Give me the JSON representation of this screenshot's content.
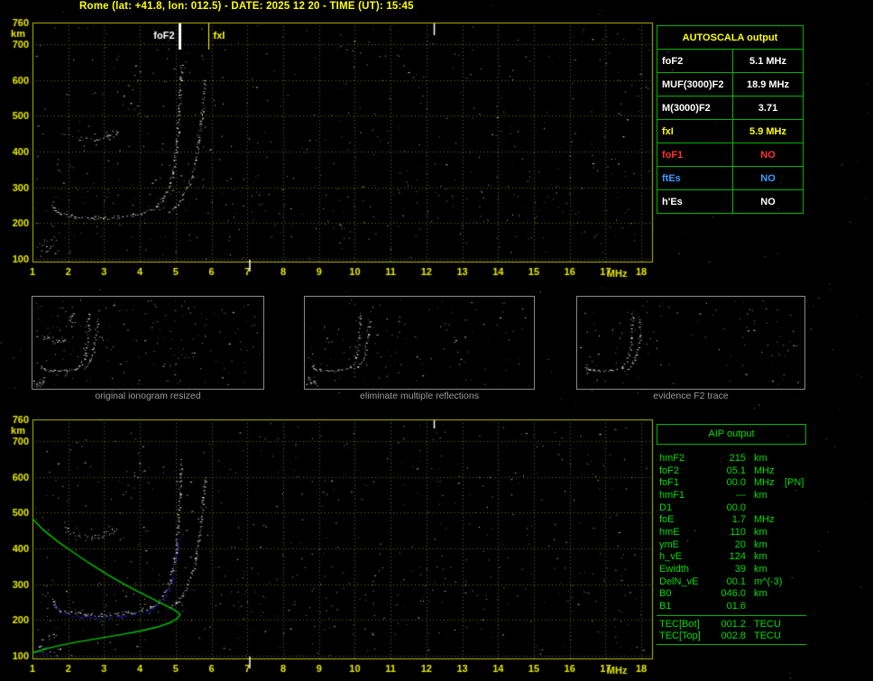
{
  "header": {
    "title": "Rome (lat: +41.8, lon: 012.5) - DATE: 2025 12 20 - TIME (UT): 15:45"
  },
  "colors": {
    "background": "#000000",
    "title_yellow": "#ffff00",
    "axis_text": "#e8e800",
    "plot_border": "#b9b900",
    "grid": "#6f6f00",
    "table_green": "#00b400",
    "aip_text": "#00dd00",
    "caption_gray": "#9a9a9a",
    "trace_white": "#ffffff",
    "trace_blue": "#2828ff",
    "profile_green": "#00c800",
    "status_red": "#ff3232",
    "status_blue": "#3d9bff"
  },
  "autoscala_table": {
    "title": "AUTOSCALA output",
    "rows": [
      {
        "label": "foF2",
        "value": "5.1 MHz",
        "color": "#ffffff"
      },
      {
        "label": "MUF(3000)F2",
        "value": "18.9 MHz",
        "color": "#ffffff"
      },
      {
        "label": "M(3000)F2",
        "value": "3.71",
        "color": "#ffffff"
      },
      {
        "label": "fxI",
        "value": "5.9 MHz",
        "color": "#ffff00"
      },
      {
        "label": "foF1",
        "value": "NO",
        "color": "#ff3232"
      },
      {
        "label": "ftEs",
        "value": "NO",
        "color": "#3d9bff"
      },
      {
        "label": "h'Es",
        "value": "NO",
        "color": "#ffffff"
      }
    ]
  },
  "aip_table": {
    "title": "AIP output",
    "rows": [
      {
        "label": "hmF2",
        "value": "215",
        "unit": "km"
      },
      {
        "label": "foF2",
        "value": "05.1",
        "unit": "MHz"
      },
      {
        "label": "foF1",
        "value": "00.0",
        "unit": "MHz",
        "note": "[PN]"
      },
      {
        "label": "hmF1",
        "value": "---",
        "unit": "km"
      },
      {
        "label": "D1",
        "value": "00.0",
        "unit": ""
      },
      {
        "label": "foE",
        "value": "1.7",
        "unit": "MHz"
      },
      {
        "label": "hmE",
        "value": "110",
        "unit": "km"
      },
      {
        "label": "ymE",
        "value": "20",
        "unit": "km"
      },
      {
        "label": "h_vE",
        "value": "124",
        "unit": "km"
      },
      {
        "label": "Ewidth",
        "value": "39",
        "unit": "km"
      },
      {
        "label": "DelN_vE",
        "value": "00.1",
        "unit": "m^(-3)"
      },
      {
        "label": "B0",
        "value": "046.0",
        "unit": "km"
      },
      {
        "label": "B1",
        "value": "01.6",
        "unit": ""
      }
    ],
    "tec": [
      {
        "label": "TEC[Bot]",
        "value": "001.2",
        "unit": "TECU"
      },
      {
        "label": "TEC[Top]",
        "value": "002.8",
        "unit": "TECU"
      }
    ]
  },
  "thumbnails": [
    {
      "caption": "original ionogram resized",
      "seed": 11,
      "noise": 180,
      "skip": []
    },
    {
      "caption": "eliminate multiple reflections",
      "seed": 12,
      "noise": 125,
      "skip": [
        "E-multiples",
        "F-multiples"
      ]
    },
    {
      "caption": "evidence F2 trace",
      "seed": 13,
      "noise": 110,
      "skip": [
        "E-multiples",
        "F-multiples",
        "low-left-cluster"
      ]
    }
  ],
  "chart_data": [
    {
      "id": "top_ionogram",
      "type": "scatter",
      "title": "scaled ionogram",
      "xlabel": "MHz",
      "ylabel": "km",
      "xlim": [
        1,
        18.3
      ],
      "ylim": [
        93,
        760
      ],
      "xticks": [
        1,
        2,
        3,
        4,
        5,
        6,
        7,
        8,
        9,
        10,
        11,
        12,
        13,
        14,
        15,
        16,
        17,
        18
      ],
      "yticks": [
        100,
        200,
        300,
        400,
        500,
        600,
        700,
        760
      ],
      "grid": true,
      "annotations": [
        {
          "label": "foF2",
          "x": 5.1,
          "color": "#ffffff",
          "thick": 3,
          "side": "left"
        },
        {
          "label": "fxI",
          "x": 5.9,
          "color": "#ffff00",
          "thick": 1,
          "side": "right"
        }
      ],
      "rfi": [
        {
          "x": 12.2,
          "edge": "top",
          "len": 13
        },
        {
          "x": 7.05,
          "edge": "bottom",
          "len": 13
        }
      ],
      "series": [
        {
          "name": "E-F1-trace",
          "color": "#ffffff",
          "style": "trace",
          "width": 2,
          "points": [
            [
              1.55,
              258
            ],
            [
              1.62,
              240
            ],
            [
              1.75,
              228
            ],
            [
              1.95,
              222
            ],
            [
              2.2,
              218
            ],
            [
              2.6,
              216
            ],
            [
              3.0,
              216
            ],
            [
              3.4,
              218
            ],
            [
              3.75,
              222
            ],
            [
              4.05,
              228
            ],
            [
              4.3,
              237
            ],
            [
              4.45,
              248
            ]
          ]
        },
        {
          "name": "F2-O-trace",
          "color": "#ffffff",
          "style": "trace",
          "width": 2,
          "points": [
            [
              4.45,
              248
            ],
            [
              4.6,
              264
            ],
            [
              4.72,
              284
            ],
            [
              4.82,
              308
            ],
            [
              4.9,
              338
            ],
            [
              4.96,
              372
            ],
            [
              5.01,
              412
            ],
            [
              5.05,
              458
            ],
            [
              5.08,
              508
            ],
            [
              5.11,
              558
            ],
            [
              5.13,
              606
            ],
            [
              5.15,
              645
            ]
          ]
        },
        {
          "name": "F2-X-trace",
          "color": "#ffffff",
          "style": "trace",
          "width": 1.5,
          "points": [
            [
              4.78,
              232
            ],
            [
              4.98,
              248
            ],
            [
              5.16,
              270
            ],
            [
              5.32,
              298
            ],
            [
              5.45,
              332
            ],
            [
              5.55,
              375
            ],
            [
              5.63,
              425
            ],
            [
              5.7,
              485
            ],
            [
              5.76,
              545
            ],
            [
              5.8,
              600
            ]
          ]
        },
        {
          "name": "E-multiples",
          "color": "#ffffff",
          "style": "cluster",
          "points": [
            [
              1.9,
              452
            ],
            [
              2.05,
              446
            ],
            [
              2.2,
              441
            ],
            [
              2.35,
              437
            ],
            [
              2.5,
              435
            ],
            [
              2.65,
              434
            ],
            [
              2.8,
              435
            ],
            [
              2.95,
              437
            ],
            [
              3.1,
              440
            ],
            [
              3.25,
              443
            ],
            [
              1.95,
              462
            ],
            [
              2.3,
              454
            ],
            [
              2.7,
              449
            ],
            [
              3.05,
              451
            ],
            [
              3.3,
              456
            ]
          ]
        },
        {
          "name": "F-multiples",
          "color": "#ffffff",
          "style": "cluster",
          "points": [
            [
              3.6,
              558
            ],
            [
              3.72,
              582
            ],
            [
              3.85,
              608
            ],
            [
              3.68,
              540
            ],
            [
              3.82,
              568
            ],
            [
              3.95,
              598
            ],
            [
              3.92,
              636
            ],
            [
              4.05,
              620
            ]
          ]
        },
        {
          "name": "low-left-cluster",
          "color": "#ffffff",
          "style": "cluster",
          "points": [
            [
              1.2,
              128
            ],
            [
              1.35,
              120
            ],
            [
              1.55,
              112
            ],
            [
              1.3,
              142
            ],
            [
              1.5,
              132
            ],
            [
              1.7,
              120
            ],
            [
              1.4,
              152
            ],
            [
              1.6,
              158
            ],
            [
              1.25,
              108
            ]
          ]
        }
      ]
    },
    {
      "id": "bottom_ionogram",
      "type": "scatter",
      "title": "ionogram with autoscaled trace and electron density profile",
      "xlabel": "MHz",
      "ylabel": "km",
      "xlim": [
        1,
        18.3
      ],
      "ylim": [
        93,
        760
      ],
      "xticks": [
        1,
        2,
        3,
        4,
        5,
        6,
        7,
        8,
        9,
        10,
        11,
        12,
        13,
        14,
        15,
        16,
        17,
        18
      ],
      "yticks": [
        100,
        200,
        300,
        400,
        500,
        600,
        700,
        760
      ],
      "grid": true,
      "annotations": [],
      "rfi": [
        {
          "x": 12.2,
          "edge": "top",
          "len": 9
        },
        {
          "x": 7.05,
          "edge": "bottom",
          "len": 13
        }
      ],
      "series": [
        {
          "name": "E-F1-trace",
          "color": "#ffffff",
          "style": "trace",
          "width": 2,
          "points": [
            [
              1.55,
              258
            ],
            [
              1.62,
              240
            ],
            [
              1.75,
              228
            ],
            [
              1.95,
              222
            ],
            [
              2.2,
              218
            ],
            [
              2.6,
              216
            ],
            [
              3.0,
              216
            ],
            [
              3.4,
              218
            ],
            [
              3.75,
              222
            ],
            [
              4.05,
              228
            ],
            [
              4.3,
              237
            ],
            [
              4.45,
              248
            ]
          ]
        },
        {
          "name": "F2-O-trace",
          "color": "#ffffff",
          "style": "trace",
          "width": 2,
          "points": [
            [
              4.45,
              248
            ],
            [
              4.6,
              264
            ],
            [
              4.72,
              284
            ],
            [
              4.82,
              308
            ],
            [
              4.9,
              338
            ],
            [
              4.96,
              372
            ],
            [
              5.01,
              412
            ],
            [
              5.05,
              458
            ],
            [
              5.08,
              508
            ],
            [
              5.11,
              558
            ],
            [
              5.13,
              606
            ],
            [
              5.15,
              645
            ]
          ]
        },
        {
          "name": "F2-X-trace",
          "color": "#ffffff",
          "style": "trace",
          "width": 1.5,
          "points": [
            [
              4.78,
              232
            ],
            [
              4.98,
              248
            ],
            [
              5.16,
              270
            ],
            [
              5.32,
              298
            ],
            [
              5.45,
              332
            ],
            [
              5.55,
              375
            ],
            [
              5.63,
              425
            ],
            [
              5.7,
              485
            ],
            [
              5.76,
              545
            ],
            [
              5.8,
              600
            ]
          ]
        },
        {
          "name": "E-multiples",
          "color": "#ffffff",
          "style": "cluster",
          "points": [
            [
              1.9,
              452
            ],
            [
              2.05,
              446
            ],
            [
              2.2,
              441
            ],
            [
              2.35,
              437
            ],
            [
              2.5,
              435
            ],
            [
              2.65,
              434
            ],
            [
              2.8,
              435
            ],
            [
              2.95,
              437
            ],
            [
              3.1,
              440
            ],
            [
              3.25,
              443
            ],
            [
              1.95,
              462
            ],
            [
              2.3,
              454
            ],
            [
              2.7,
              449
            ],
            [
              3.05,
              451
            ],
            [
              3.3,
              456
            ]
          ]
        },
        {
          "name": "F-multiples",
          "color": "#ffffff",
          "style": "cluster",
          "points": [
            [
              3.6,
              558
            ],
            [
              3.72,
              582
            ],
            [
              3.85,
              608
            ],
            [
              3.68,
              540
            ],
            [
              3.82,
              568
            ],
            [
              3.95,
              598
            ],
            [
              3.92,
              636
            ],
            [
              4.05,
              620
            ]
          ]
        },
        {
          "name": "low-left-cluster",
          "color": "#ffffff",
          "style": "cluster",
          "points": [
            [
              1.2,
              128
            ],
            [
              1.35,
              120
            ],
            [
              1.55,
              112
            ],
            [
              1.3,
              142
            ],
            [
              1.5,
              132
            ],
            [
              1.7,
              120
            ],
            [
              1.4,
              152
            ],
            [
              1.6,
              158
            ],
            [
              1.25,
              108
            ]
          ]
        },
        {
          "name": "autoscala-E-points",
          "color": "#2828ff",
          "style": "trace",
          "width": 2,
          "points": [
            [
              1.6,
              250
            ],
            [
              1.75,
              222
            ],
            [
              2.0,
              215
            ],
            [
              2.3,
              211
            ],
            [
              2.7,
              209
            ],
            [
              3.1,
              209
            ],
            [
              3.5,
              211
            ],
            [
              3.9,
              216
            ],
            [
              4.2,
              223
            ],
            [
              4.45,
              240
            ]
          ]
        },
        {
          "name": "autoscala-F2-points",
          "color": "#2828ff",
          "style": "trace",
          "width": 2,
          "points": [
            [
              4.45,
              240
            ],
            [
              4.65,
              258
            ],
            [
              4.8,
              282
            ],
            [
              4.9,
              315
            ],
            [
              4.97,
              360
            ],
            [
              5.03,
              405
            ],
            [
              5.08,
              430
            ]
          ]
        },
        {
          "name": "corner-blue-cluster",
          "color": "#2828ff",
          "style": "cluster",
          "points": [
            [
              1.02,
              98
            ],
            [
              1.1,
              106
            ],
            [
              1.25,
              102
            ],
            [
              1.05,
              116
            ],
            [
              1.18,
              95
            ],
            [
              1.35,
              99
            ],
            [
              1.03,
              128
            ],
            [
              1.45,
              105
            ],
            [
              1.6,
              100
            ]
          ]
        }
      ],
      "profile": {
        "name": "electron-density-profile",
        "color": "#00c800",
        "points": [
          [
            1.0,
            483
          ],
          [
            1.3,
            452
          ],
          [
            1.7,
            420
          ],
          [
            2.1,
            392
          ],
          [
            2.6,
            358
          ],
          [
            3.1,
            327
          ],
          [
            3.6,
            298
          ],
          [
            4.1,
            272
          ],
          [
            4.5,
            252
          ],
          [
            4.8,
            237
          ],
          [
            5.0,
            226
          ],
          [
            5.1,
            218
          ],
          [
            5.12,
            215
          ],
          [
            5.05,
            205
          ],
          [
            4.85,
            193
          ],
          [
            4.5,
            181
          ],
          [
            4.0,
            169
          ],
          [
            3.4,
            158
          ],
          [
            2.8,
            148
          ],
          [
            2.2,
            138
          ],
          [
            1.7,
            128
          ],
          [
            1.3,
            118
          ],
          [
            1.05,
            110
          ],
          [
            1.0,
            107
          ]
        ]
      }
    }
  ]
}
